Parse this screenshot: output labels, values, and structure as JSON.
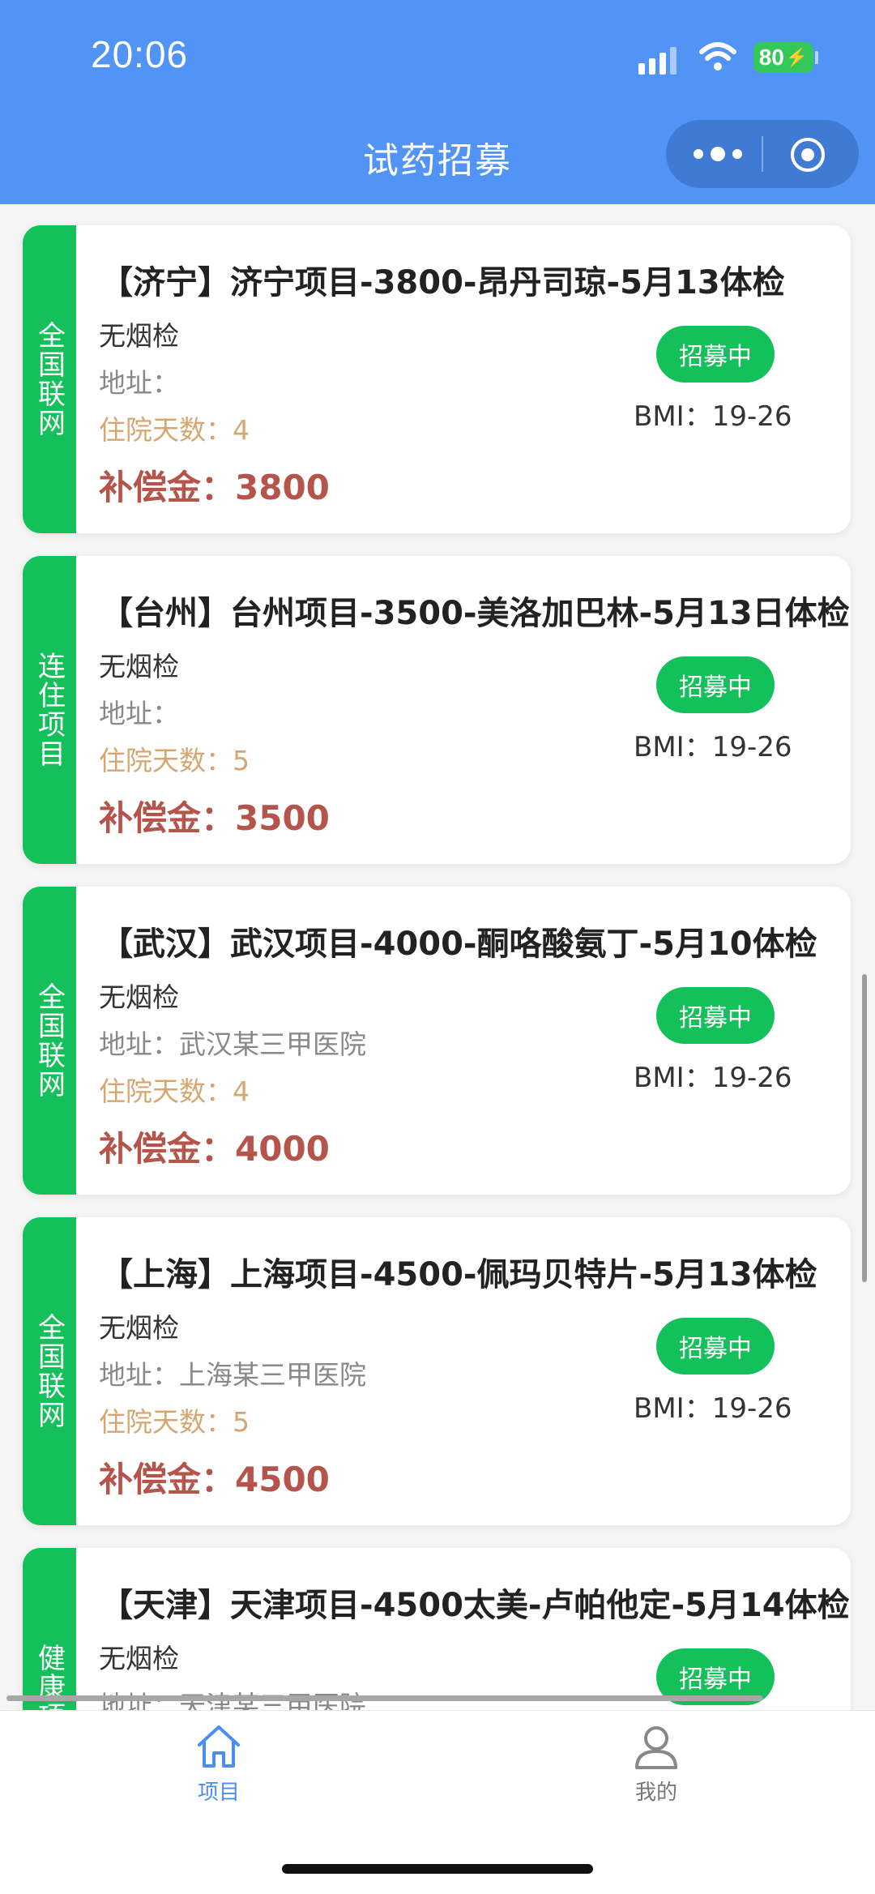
{
  "status": {
    "time": "20:06",
    "battery": "80"
  },
  "nav": {
    "title": "试药招募"
  },
  "labels": {
    "address": "地址：",
    "days": "住院天数：",
    "comp": "补偿金：",
    "bmi": "BMI："
  },
  "cards": [
    {
      "tag": "全国联网",
      "title": "【济宁】济宁项目-3800-昂丹司琼-5月13体检",
      "smoke": "无烟检",
      "address": "",
      "days": "4",
      "comp": "3800",
      "status": "招募中",
      "bmi": "19-26"
    },
    {
      "tag": "连住项目",
      "title": "【台州】台州项目-3500-美洛加巴林-5月13日体检",
      "smoke": "无烟检",
      "address": "",
      "days": "5",
      "comp": "3500",
      "status": "招募中",
      "bmi": "19-26"
    },
    {
      "tag": "全国联网",
      "title": "【武汉】武汉项目-4000-酮咯酸氨丁-5月10体检",
      "smoke": "无烟检",
      "address": "武汉某三甲医院",
      "days": "4",
      "comp": "4000",
      "status": "招募中",
      "bmi": "19-26"
    },
    {
      "tag": "全国联网",
      "title": "【上海】上海项目-4500-佩玛贝特片-5月13体检",
      "smoke": "无烟检",
      "address": "上海某三甲医院",
      "days": "5",
      "comp": "4500",
      "status": "招募中",
      "bmi": "19-26"
    },
    {
      "tag": "健康项目",
      "title": "【天津】天津项目-4500太美-卢帕他定-5月14体检",
      "smoke": "无烟检",
      "address": "天津某三甲医院",
      "days": "",
      "comp": "",
      "status": "招募中",
      "bmi": ""
    }
  ],
  "tabs": [
    {
      "label": "项目",
      "icon": "home-icon",
      "active": true
    },
    {
      "label": "我的",
      "icon": "user-icon",
      "active": false
    }
  ],
  "colors": {
    "primary": "#5294f5",
    "tag_green": "#13c05a",
    "compensation": "#b5544b",
    "days": "#d5a66e"
  }
}
